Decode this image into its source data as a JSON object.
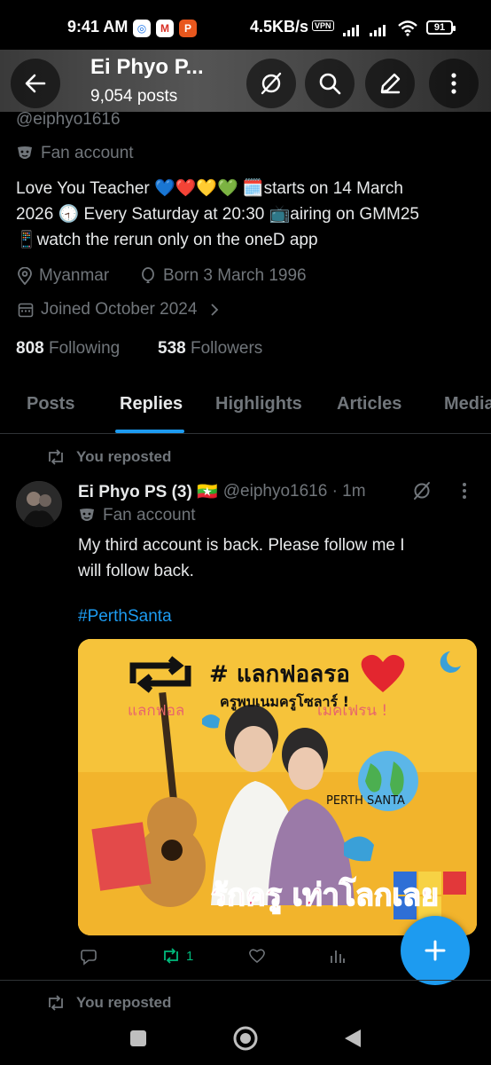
{
  "status_bar": {
    "time": "9:41 AM",
    "network_speed": "4.5KB/s",
    "vpn": "VPN",
    "battery": "91"
  },
  "header": {
    "title": "Ei Phyo P...",
    "subtitle": "9,054 posts"
  },
  "profile": {
    "handle": "@eiphyo1616",
    "category": "Fan account",
    "bio_lines": [
      "Love You Teacher 💙❤️💛💚 🗓️starts on 14 March",
      "2026 🕣 Every Saturday at 20:30 📺airing on GMM25",
      "📱watch the rerun only on the oneD app"
    ],
    "location": "Myanmar",
    "born": "Born 3 March 1996",
    "joined": "Joined October 2024",
    "following_count": "808",
    "following_label": "Following",
    "followers_count": "538",
    "followers_label": "Followers"
  },
  "tabs": [
    {
      "label": "Posts",
      "active": false
    },
    {
      "label": "Replies",
      "active": true
    },
    {
      "label": "Highlights",
      "active": false
    },
    {
      "label": "Articles",
      "active": false
    },
    {
      "label": "Media",
      "active": false
    }
  ],
  "post": {
    "repost_label": "You reposted",
    "author_name": "Ei Phyo PS (3) 🇲🇲",
    "author_handle": "@eiphyo1616 · 1m",
    "author_category": "Fan account",
    "text_lines": [
      "My third account is back. Please follow me I",
      "will follow back."
    ],
    "hashtag": "#PerthSanta",
    "media": {
      "title": "# แลกฟอลรอ",
      "subtitle": "ครูพบเนมครูโซลาร์ !",
      "left_text": "แลกฟอล",
      "right_text": "เมคเฟรน !",
      "tag": "PERTH SANTA",
      "bottom_text": "รักครู เท่าโลกเลย"
    },
    "actions": {
      "reposts": "1"
    }
  },
  "next_post": {
    "repost_label": "You reposted"
  },
  "colors": {
    "accent": "#1d9bf0",
    "repost_green": "#00ba7c",
    "muted": "#71767b"
  }
}
